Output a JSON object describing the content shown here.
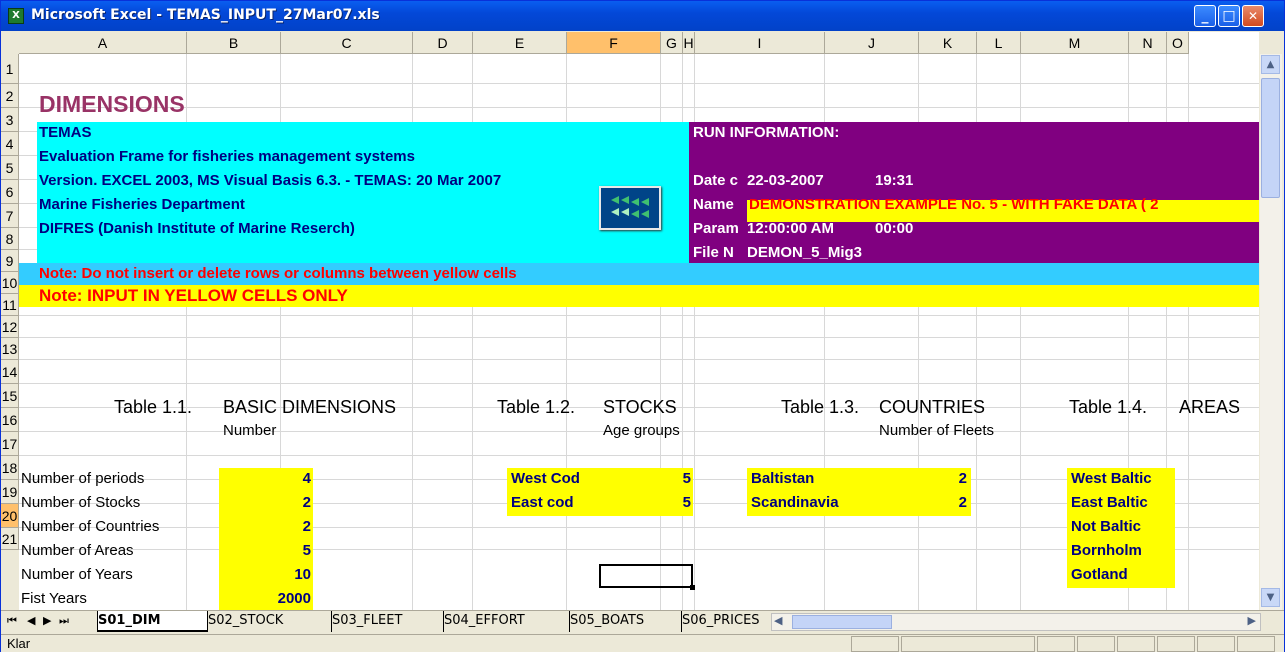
{
  "window": {
    "title": "Microsoft Excel - TEMAS_INPUT_27Mar07.xls",
    "min": "_",
    "max": "□",
    "close": "✕"
  },
  "columns": [
    "A",
    "B",
    "C",
    "D",
    "E",
    "F",
    "G",
    "H",
    "I",
    "J",
    "K",
    "L",
    "M",
    "N",
    "O"
  ],
  "rows": [
    "1",
    "2",
    "3",
    "4",
    "5",
    "6",
    "7",
    "8",
    "9",
    "10",
    "11",
    "12",
    "13",
    "14",
    "15",
    "16",
    "17",
    "18",
    "19",
    "20",
    "21"
  ],
  "cells": {
    "a1": "DIMENSIONS",
    "a2": "TEMAS",
    "a3": "Evaluation Frame for fisheries management systems",
    "a4": "Version. EXCEL 2003, MS Visual Basis 6.3. - TEMAS: 20 Mar 2007",
    "a5": "Marine Fisheries Department",
    "a6": "DIFRES (Danish Institute of Marine Reserch)",
    "g2": "RUN INFORMATION:",
    "g4_label": "Date c",
    "g4_date": "22-03-2007",
    "g4_time": "19:31",
    "g5_label": "Name",
    "g5_value": "DEMONSTRATION EXAMPLE No. 5 -  WITH FAKE DATA (  2",
    "g6_label": "Param",
    "g6_value": "12:00:00 AM",
    "g6_time": "00:00",
    "g7_label": "File N",
    "g7_value": "DEMON_5_Mig3",
    "a8": "Note: Do not insert or delete rows or columns between yellow cells",
    "a9": "Note: INPUT IN YELLOW CELLS ONLY",
    "t11": "Table 1.1.",
    "t11b": "BASIC DIMENSIONS",
    "t12": "Table 1.2.",
    "t12b": "STOCKS",
    "t13": "Table 1.3.",
    "t13b": "COUNTRIES",
    "t14": "Table 1.4.",
    "t14b": "AREAS",
    "b14": "Number",
    "f14": "Age groups",
    "j14": "Number of Fleets"
  },
  "basic_dims": [
    {
      "label": "Number of periods",
      "value": "4"
    },
    {
      "label": "Number of Stocks",
      "value": "2"
    },
    {
      "label": "Number of Countries",
      "value": "2"
    },
    {
      "label": "Number of Areas",
      "value": "5"
    },
    {
      "label": "Number of Years",
      "value": "10"
    },
    {
      "label": "Fist Years",
      "value": "2000"
    }
  ],
  "stocks": [
    {
      "name": "West Cod",
      "value": "5"
    },
    {
      "name": "East cod",
      "value": "5"
    }
  ],
  "countries": [
    {
      "name": "Baltistan",
      "value": "2"
    },
    {
      "name": "Scandinavia",
      "value": "2"
    }
  ],
  "areas": [
    "West Baltic",
    "East Baltic",
    "Not Baltic",
    "Bornholm",
    "Gotland"
  ],
  "tabs": [
    "S01_DIM",
    "S02_STOCK",
    "S03_FLEET",
    "S04_EFFORT",
    "S05_BOATS",
    "S06_PRICES"
  ],
  "status": {
    "text": "Klar"
  },
  "colors": {
    "cyan": "#00ffff",
    "purple": "#800080",
    "yellow": "#ffff00",
    "skyblue": "#33ccff",
    "maroon": "#993366",
    "red": "#ff0000",
    "navy": "#000080"
  }
}
